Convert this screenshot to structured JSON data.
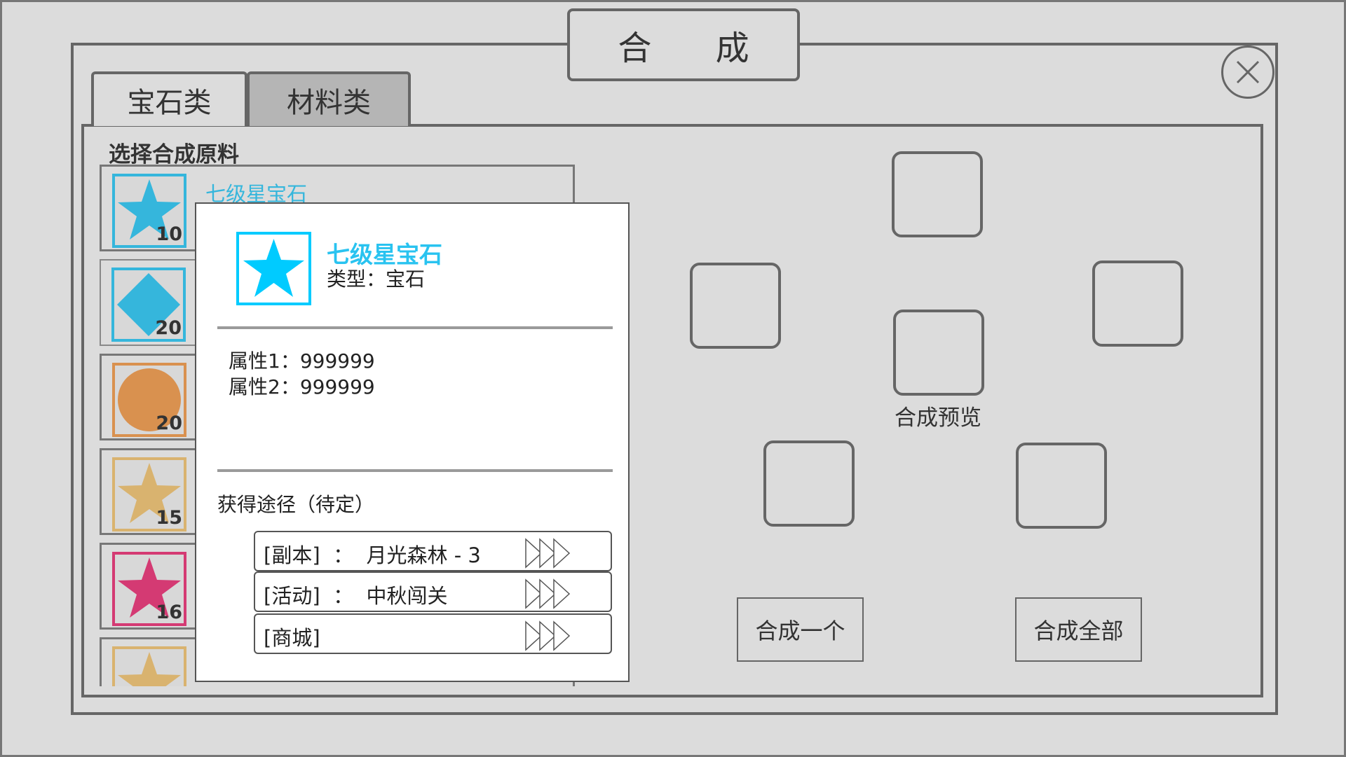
{
  "window": {
    "title": "合 成"
  },
  "tabs": [
    {
      "label": "宝石类",
      "active": false
    },
    {
      "label": "材料类",
      "active": true
    }
  ],
  "material_list": {
    "heading": "选择合成原料",
    "items": [
      {
        "name": "七级星宝石",
        "count": "10",
        "shape": "star",
        "color": "#35b6dc"
      },
      {
        "name": "",
        "count": "20",
        "shape": "diamond",
        "color": "#35b6dc"
      },
      {
        "name": "",
        "count": "20",
        "shape": "circle",
        "color": "#d9914f"
      },
      {
        "name": "",
        "count": "15",
        "shape": "star",
        "color": "#d9b36f"
      },
      {
        "name": "",
        "count": "16",
        "shape": "star",
        "color": "#d43a73"
      },
      {
        "name": "",
        "count": "",
        "shape": "star",
        "color": "#d9b36f"
      }
    ]
  },
  "tooltip": {
    "name": "七级星宝石",
    "type_line": "类型：宝石",
    "icon": "star-icon",
    "icon_color": "#00cbff",
    "attributes": [
      "属性1：999999",
      "属性2：999999"
    ],
    "source_heading": "获得途径（待定）",
    "sources": [
      {
        "label": "[副本]  ：  月光森林 - 3"
      },
      {
        "label": "[活动]  ：  中秋闯关"
      },
      {
        "label": "[商城]"
      }
    ]
  },
  "synthesis": {
    "preview_label": "合成预览",
    "synth_one_label": "合成一个",
    "synth_all_label": "合成全部"
  },
  "colors": {
    "background": "#dcdcdc",
    "border": "#666666",
    "accent_cyan": "#35b6dc"
  }
}
